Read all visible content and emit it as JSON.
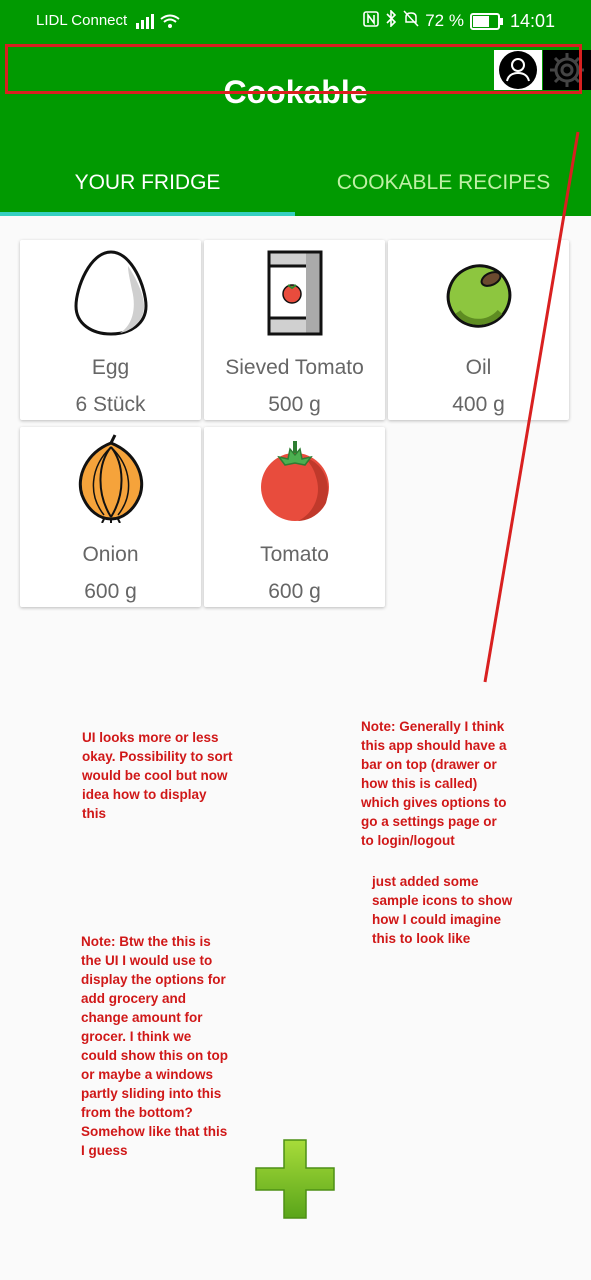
{
  "status_bar": {
    "carrier": "LIDL Connect",
    "battery": "72 %",
    "battery_level": 0.72,
    "time": "14:01"
  },
  "app_bar": {
    "title": "Cookable",
    "icons": [
      "user-icon",
      "gear-icon"
    ]
  },
  "tabs": [
    {
      "label": "YOUR FRIDGE",
      "active": true
    },
    {
      "label": "COOKABLE RECIPES",
      "active": false
    }
  ],
  "items": [
    {
      "name": "Egg",
      "qty": "6 Stück",
      "icon": "egg-icon"
    },
    {
      "name": "Sieved Tomato",
      "qty": "500 g",
      "icon": "sieved-tomato-icon"
    },
    {
      "name": "Oil",
      "qty": "400 g",
      "icon": "olive-icon"
    },
    {
      "name": "Onion",
      "qty": "600 g",
      "icon": "onion-icon"
    },
    {
      "name": "Tomato",
      "qty": "600 g",
      "icon": "tomato-icon"
    }
  ],
  "notes": {
    "note1": [
      "UI looks more or less",
      "okay. Possibility to sort",
      "would be cool but now",
      "idea how to display",
      "this"
    ],
    "note2": [
      "Note: Generally I think",
      "this app should have a",
      "bar on top (drawer or",
      "how this is called)",
      "which gives options to",
      "go a settings page or",
      "to login/logout"
    ],
    "note3": [
      "just added some",
      "sample icons to show",
      "how I could imagine",
      "this to look like"
    ],
    "note4": [
      "Note: Btw the this is",
      "the UI I would use to",
      "display the options for",
      "add grocery and",
      "change amount for",
      "grocer. I think we",
      "could show this on top",
      "or maybe a windows",
      "partly sliding into this",
      "from the bottom?",
      "Somehow like that this",
      "I guess"
    ]
  },
  "colors": {
    "primary": "#019a01",
    "tab_indicator": "#35d0c0",
    "annotation": "#d01818",
    "fab": "#7cc52a"
  }
}
